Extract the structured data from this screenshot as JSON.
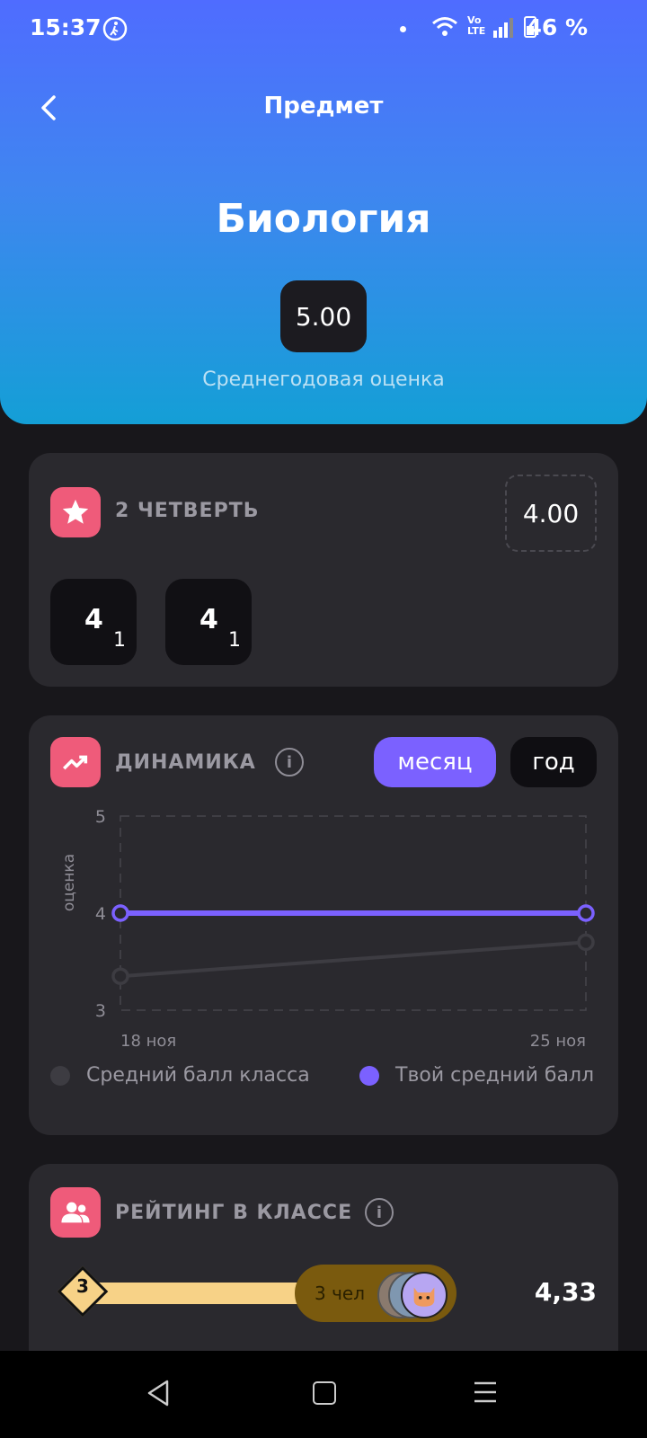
{
  "status": {
    "time": "15:37",
    "battery": "46 %"
  },
  "header": {
    "title": "Предмет",
    "subject": "Биология",
    "year_avg": "5.00",
    "year_avg_label": "Среднегодовая оценка"
  },
  "quarter": {
    "title": "2 ЧЕТВЕРТЬ",
    "avg": "4.00",
    "grades": [
      {
        "value": "4",
        "weight": "1"
      },
      {
        "value": "4",
        "weight": "1"
      }
    ]
  },
  "dynamics": {
    "title": "ДИНАМИКА",
    "tab_month": "месяц",
    "tab_year": "год",
    "legend_class": "Средний балл класса",
    "legend_mine": "Твой средний балл"
  },
  "chart_data": {
    "type": "line",
    "ylabel": "оценка",
    "xlabel": "",
    "ylim": [
      3,
      5
    ],
    "yticks": [
      "5",
      "4",
      "3"
    ],
    "x": [
      "18 ноя",
      "25 ноя"
    ],
    "series": [
      {
        "name": "Средний балл класса",
        "values": [
          3.35,
          3.7
        ],
        "color": "#3d3c42"
      },
      {
        "name": "Твой средний балл",
        "values": [
          4,
          4
        ],
        "color": "#7b61ff"
      }
    ]
  },
  "rating": {
    "title": "РЕЙТИНГ В КЛАССЕ",
    "place": "3",
    "people": "3 чел",
    "score": "4,33"
  },
  "colors": {
    "accent": "#7b61ff",
    "badge": "#ef5b7a",
    "rating_bar": "#f7d287",
    "rating_pill": "#7a5a0e"
  }
}
